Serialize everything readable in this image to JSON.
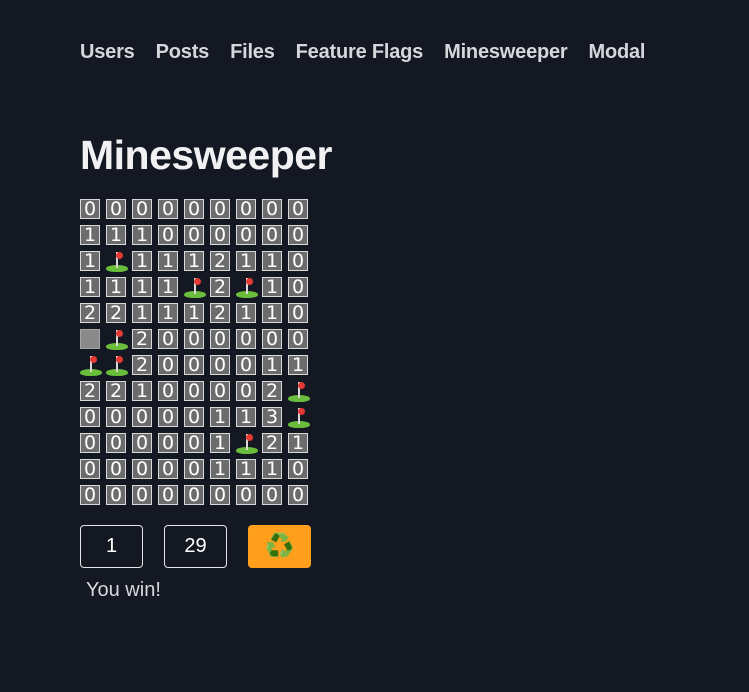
{
  "nav": {
    "links": [
      {
        "name": "nav-users",
        "label": "Users"
      },
      {
        "name": "nav-posts",
        "label": "Posts"
      },
      {
        "name": "nav-files",
        "label": "Files"
      },
      {
        "name": "nav-feature-flags",
        "label": "Feature Flags"
      },
      {
        "name": "nav-minesweeper",
        "label": "Minesweeper"
      },
      {
        "name": "nav-modal",
        "label": "Modal"
      }
    ]
  },
  "page": {
    "title": "Minesweeper"
  },
  "board": {
    "rows": [
      [
        "0",
        "0",
        "0",
        "0",
        "0",
        "0",
        "0",
        "0",
        "0"
      ],
      [
        "1",
        "1",
        "1",
        "0",
        "0",
        "0",
        "0",
        "0",
        "0"
      ],
      [
        "1",
        "F",
        "1",
        "1",
        "1",
        "2",
        "1",
        "1",
        "0"
      ],
      [
        "1",
        "1",
        "1",
        "1",
        "F",
        "2",
        "F",
        "1",
        "0"
      ],
      [
        "2",
        "2",
        "1",
        "1",
        "1",
        "2",
        "1",
        "1",
        "0"
      ],
      [
        "H",
        "F",
        "2",
        "0",
        "0",
        "0",
        "0",
        "0",
        "0"
      ],
      [
        "F",
        "F",
        "2",
        "0",
        "0",
        "0",
        "0",
        "1",
        "1"
      ],
      [
        "2",
        "2",
        "1",
        "0",
        "0",
        "0",
        "0",
        "2",
        "F"
      ],
      [
        "0",
        "0",
        "0",
        "0",
        "0",
        "1",
        "1",
        "3",
        "F"
      ],
      [
        "0",
        "0",
        "0",
        "0",
        "0",
        "1",
        "F",
        "2",
        "1"
      ],
      [
        "0",
        "0",
        "0",
        "0",
        "0",
        "1",
        "1",
        "1",
        "0"
      ],
      [
        "0",
        "0",
        "0",
        "0",
        "0",
        "0",
        "0",
        "0",
        "0"
      ]
    ],
    "legend": {
      "F": "flag-icon",
      "H": "covered-cell"
    },
    "colors": {
      "revealed": "#6c6c6c",
      "covered": "#8a8a8a",
      "flag_grass": "#6bbd3c",
      "flag_red": "#e53935"
    }
  },
  "controls": {
    "flags_count": "1",
    "time_count": "29",
    "reset_icon": "♻️",
    "reset_icon_name": "recycle-icon",
    "reset_color": "#ff9f1c"
  },
  "status": {
    "message": "You win!"
  }
}
